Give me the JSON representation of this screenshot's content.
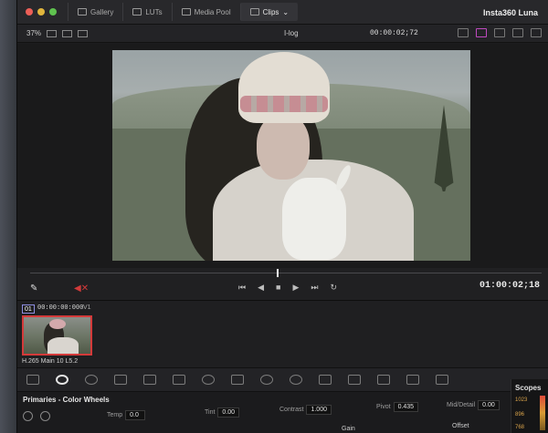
{
  "topbar": {
    "tabs": [
      {
        "label": "Gallery",
        "icon": "gallery-icon"
      },
      {
        "label": "LUTs",
        "icon": "luts-icon"
      },
      {
        "label": "Media Pool",
        "icon": "media-pool-icon"
      },
      {
        "label": "Clips",
        "icon": "clips-icon",
        "active": true
      }
    ],
    "app_title": "Insta360 Luna"
  },
  "viewer_toolbar": {
    "zoom": "37%",
    "clip_name": "I-log",
    "timecode": "00:00:02;72"
  },
  "transport": {
    "timecode": "01:00:02;18",
    "buttons": [
      "skip-back",
      "play-reverse",
      "stop",
      "play",
      "skip-forward",
      "loop"
    ],
    "mute": "muted"
  },
  "clips": {
    "number": "01",
    "timecode": "00:00:00:000",
    "track": "V1",
    "codec": "H.265 Main 10 L5.2"
  },
  "primaries": {
    "title": "Primaries - Color Wheels",
    "temp_label": "Temp",
    "temp_value": "0.0",
    "tint_label": "Tint",
    "tint_value": "0.00",
    "contrast_label": "Contrast",
    "contrast_value": "1.000",
    "pivot_label": "Pivot",
    "pivot_value": "0.435",
    "middetail_label": "Mid/Detail",
    "middetail_value": "0.00",
    "gain_label": "Gain",
    "offset_label": "Offset"
  },
  "scopes": {
    "title": "Scopes",
    "ticks": [
      "1023",
      "896",
      "768"
    ]
  },
  "colors": {
    "accent_red": "#d43a3a",
    "panel": "#1c1c1e",
    "scope_tick": "#d9a34a"
  }
}
